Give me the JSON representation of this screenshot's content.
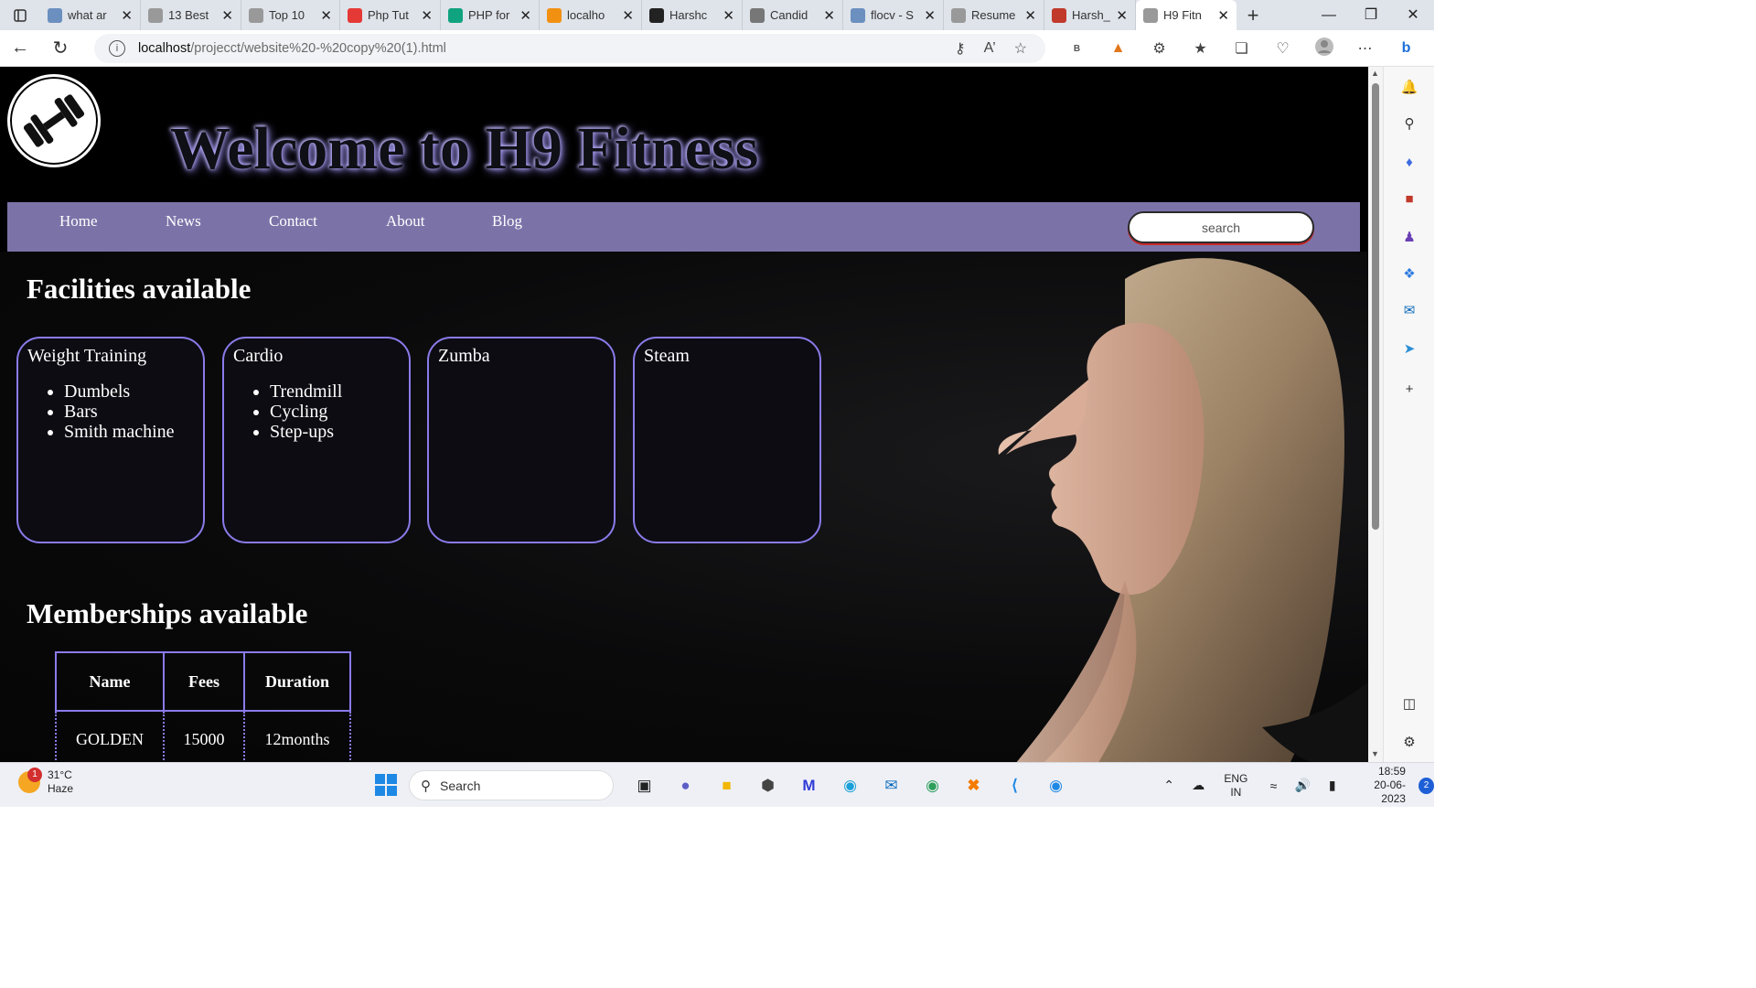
{
  "browser": {
    "tabs": [
      {
        "label": "what ar",
        "favicon": "search-icon"
      },
      {
        "label": "13 Best",
        "favicon": "site-icon"
      },
      {
        "label": "Top 10",
        "favicon": "site-icon"
      },
      {
        "label": "Php Tut",
        "favicon": "youtube-icon"
      },
      {
        "label": "PHP for",
        "favicon": "chatgpt-icon"
      },
      {
        "label": "localho",
        "favicon": "phpmyadmin-icon"
      },
      {
        "label": "Harshc",
        "favicon": "github-icon"
      },
      {
        "label": "Candid",
        "favicon": "document-icon"
      },
      {
        "label": "flocv - S",
        "favicon": "search-icon"
      },
      {
        "label": "Resume",
        "favicon": "site-icon"
      },
      {
        "label": "Harsh_",
        "favicon": "pdf-icon"
      },
      {
        "label": "H9 Fitn",
        "favicon": "site-icon",
        "active": true
      }
    ],
    "url_host": "localhost",
    "url_path": "/projecct/website%20-%20copy%20(1).html"
  },
  "site": {
    "title": "Welcome to H9 Fitness",
    "nav": [
      "Home",
      "News",
      "Contact",
      "About",
      "Blog"
    ],
    "search_placeholder": "search",
    "facilities_heading": "Facilities available",
    "facilities": [
      {
        "name": "Weight Training",
        "items": [
          "Dumbels",
          "Bars",
          "Smith machine"
        ]
      },
      {
        "name": "Cardio",
        "items": [
          "Trendmill",
          "Cycling",
          "Step-ups"
        ]
      },
      {
        "name": "Zumba",
        "items": []
      },
      {
        "name": "Steam",
        "items": []
      }
    ],
    "memberships_heading": "Memberships available",
    "memberships_table": {
      "headers": [
        "Name",
        "Fees",
        "Duration"
      ],
      "rows": [
        [
          "GOLDEN",
          "15000",
          "12months"
        ]
      ]
    },
    "colors": {
      "nav_bg": "#7b73a8",
      "card_border": "#8a7bea",
      "page_bg": "#000000"
    }
  },
  "taskbar": {
    "weather_temp": "31°C",
    "weather_desc": "Haze",
    "weather_badge": "1",
    "search_label": "Search",
    "lang_top": "ENG",
    "lang_bottom": "IN",
    "time": "18:59",
    "date": "20-06-2023",
    "notification_count": "2"
  }
}
